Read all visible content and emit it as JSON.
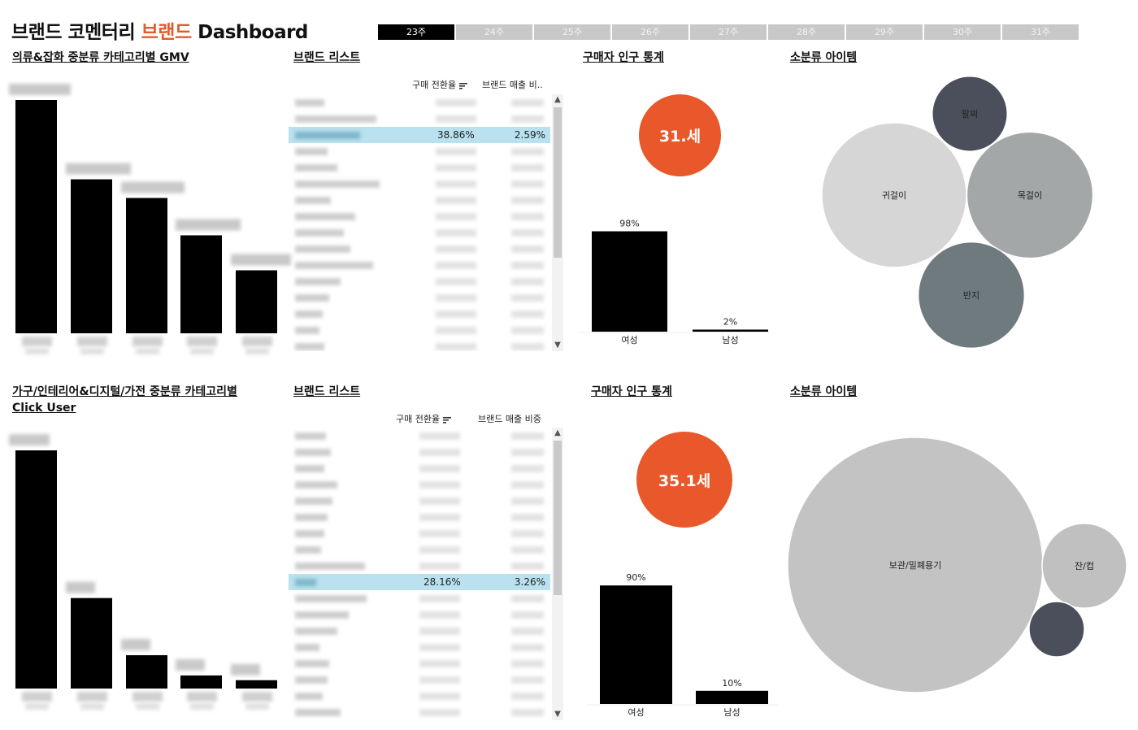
{
  "header": {
    "title_pre": "브랜드 코멘터리 ",
    "title_accent": "브랜드",
    "title_post": " Dashboard"
  },
  "weeks": [
    "23주",
    "24주",
    "25주",
    "26주",
    "27주",
    "28주",
    "29주",
    "30주",
    "31주"
  ],
  "active_week": "23주",
  "colors": {
    "accent": "#e8582a",
    "bar": "#000000",
    "selected_row": "#b9e1ef"
  },
  "top": {
    "category_title": "의류&잡화 중분류 카테고리별 GMV",
    "brand_list": {
      "title": "브랜드 리스트",
      "col1": "구매 전환율",
      "col2": "브랜드 매출 비..",
      "selected": {
        "conversion": "38.86%",
        "share": "2.59%"
      }
    },
    "demo_title": "구매자 인구 통계",
    "age": "31.세",
    "sub_title": "소분류 아이템"
  },
  "bottom": {
    "category_title_line1": "가구/인테리어&디지털/가전 중분류 카테고리별",
    "category_title_line2": "Click User",
    "brand_list": {
      "title": "브랜드 리스트",
      "col1": "구매 전환율",
      "col2": "브랜드 매출 비중",
      "selected": {
        "conversion": "28.16%",
        "share": "3.26%"
      }
    },
    "demo_title": "구매자 인구 통계",
    "age": "35.1세",
    "sub_title": "소분류 아이템"
  },
  "chart_data": [
    {
      "type": "bar",
      "title": "의류&잡화 중분류 카테고리별 GMV",
      "categories": [
        "",
        "",
        "",
        "",
        ""
      ],
      "values": [
        100,
        66,
        58,
        42,
        27
      ],
      "ylim": [
        0,
        100
      ]
    },
    {
      "type": "bar",
      "title": "구매자 인구 통계",
      "categories": [
        "여성",
        "남성"
      ],
      "values": [
        98,
        2
      ],
      "data_labels": [
        "98%",
        "2%"
      ],
      "ylim": [
        0,
        100
      ]
    },
    {
      "type": "bubble",
      "title": "소분류 아이템",
      "items": [
        {
          "label": "귀걸이",
          "value": 100,
          "color": "#d6d6d6"
        },
        {
          "label": "목걸이",
          "value": 76,
          "color": "#a3a7a8"
        },
        {
          "label": "반지",
          "value": 54,
          "color": "#6f7a7f"
        },
        {
          "label": "팔찌",
          "value": 27,
          "color": "#4b4f5c"
        }
      ]
    },
    {
      "type": "bar",
      "title": "가구/인테리어&디지털/가전 중분류 카테고리별 Click User",
      "categories": [
        "",
        "",
        "",
        "",
        ""
      ],
      "values": [
        100,
        38,
        14,
        5.5,
        3.5
      ],
      "ylim": [
        0,
        100
      ]
    },
    {
      "type": "bar",
      "title": "구매자 인구 통계",
      "categories": [
        "여성",
        "남성"
      ],
      "values": [
        90,
        10
      ],
      "data_labels": [
        "90%",
        "10%"
      ],
      "ylim": [
        0,
        100
      ]
    },
    {
      "type": "bubble",
      "title": "소분류 아이템",
      "items": [
        {
          "label": "보관/밀폐용기",
          "value": 100,
          "color": "#c2c3c2"
        },
        {
          "label": "잔/컵",
          "value": 11,
          "color": "#bfc0bf"
        },
        {
          "label": "",
          "value": 4.7,
          "color": "#4b4f5c"
        }
      ]
    }
  ]
}
